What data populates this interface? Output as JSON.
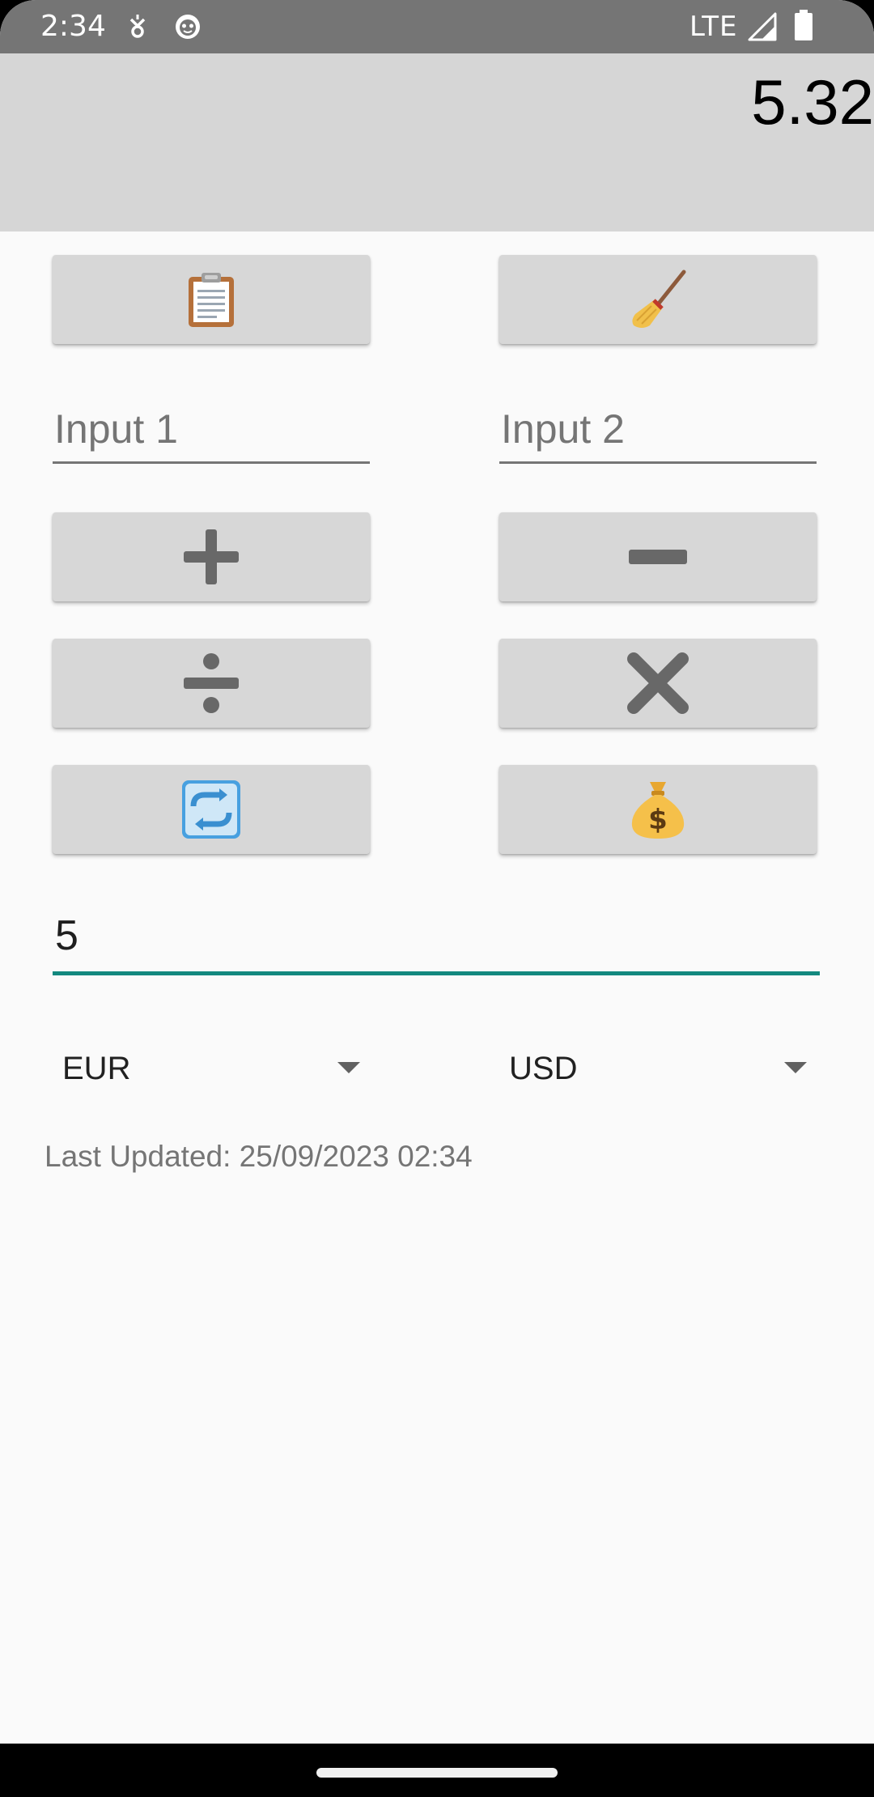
{
  "status_bar": {
    "time": "2:34",
    "network": "LTE",
    "icons": [
      "location-icon",
      "cat-face-icon",
      "signal-icon",
      "battery-icon"
    ]
  },
  "result": {
    "value": "5.32"
  },
  "buttons": {
    "paste_icon": "clipboard-icon",
    "clear_icon": "broom-icon",
    "add_icon": "plus-icon",
    "subtract_icon": "minus-icon",
    "divide_icon": "divide-icon",
    "multiply_icon": "multiply-icon",
    "swap_icon": "arrows-counterclockwise-icon",
    "convert_icon": "money-bag-icon"
  },
  "inputs": {
    "input1_placeholder": "Input 1",
    "input2_placeholder": "Input 2"
  },
  "converter": {
    "amount": "5",
    "from_currency": "EUR",
    "to_currency": "USD",
    "last_updated": "Last Updated: 25/09/2023 02:34"
  },
  "colors": {
    "status_bar": "#757575",
    "result_background": "#d6d6d6",
    "button_background": "#d7d7d7",
    "accent": "#13897f"
  }
}
